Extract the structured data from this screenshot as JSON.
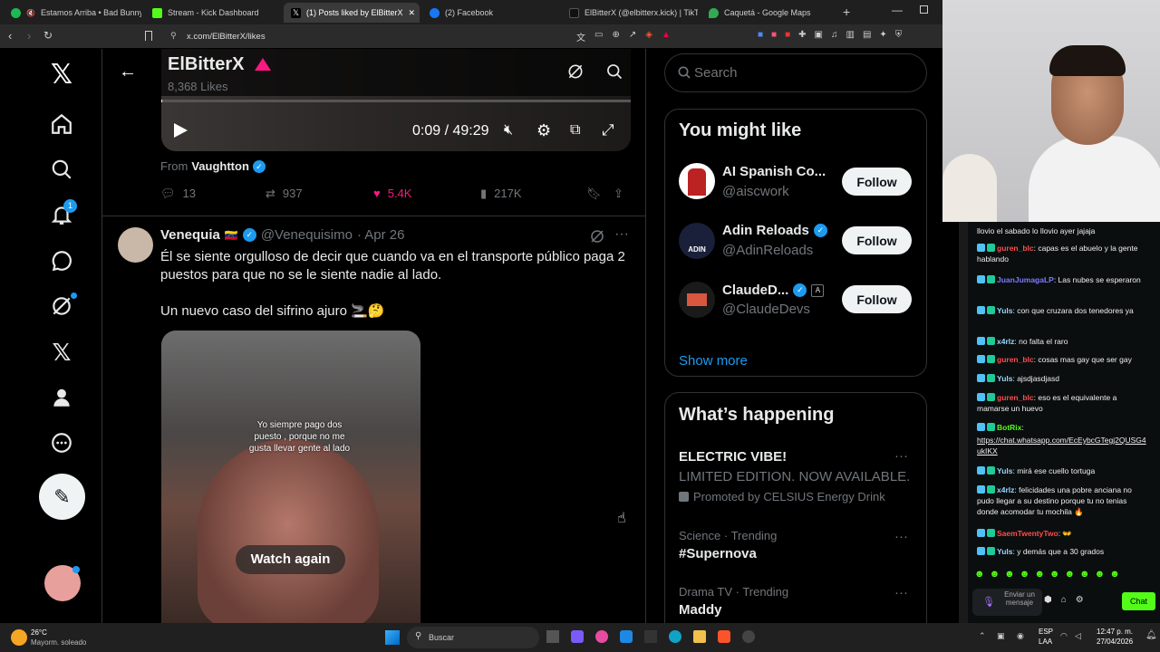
{
  "browser": {
    "tabs": [
      "Estamos Arriba • Bad Bunny, M",
      "Stream - Kick Dashboard",
      "(1) Posts liked by ElBitterX",
      "(2) Facebook",
      "ElBitterX (@elbitterx.kick) | TikTok",
      "Caquetá - Google Maps"
    ],
    "url": "x.com/ElBitterX/likes"
  },
  "profile": {
    "name": "ElBitterX",
    "likes": "8,368 Likes"
  },
  "video": {
    "time": "0:09 / 49:29",
    "from_label": "From",
    "from_name": "Vaughtton"
  },
  "post1_actions": {
    "replies": "13",
    "reposts": "937",
    "likes": "5.4K",
    "views": "217K"
  },
  "post2": {
    "name": "Venequia",
    "handle": "@Venequisimo",
    "date": "· Apr 26",
    "text1": "Él se siente orgulloso de decir que cuando va en el transporte público paga 2 puestos para que no se le siente nadie al lado.",
    "text2": "Un nuevo caso del sifrino ajuro 🚬🤔",
    "video_caption": "Yo siempre pago dos puesto , porque no me gusta llevar gente al lado",
    "watch_again": "Watch again"
  },
  "sidebar": {
    "search_placeholder": "Search",
    "might_like_title": "You might like",
    "suggestions": [
      {
        "name": "AI Spanish Co...",
        "handle": "@aiscwork",
        "follow": "Follow"
      },
      {
        "name": "Adin Reloads",
        "handle": "@AdinReloads",
        "follow": "Follow"
      },
      {
        "name": "ClaudeD...",
        "handle": "@ClaudeDevs",
        "follow": "Follow"
      }
    ],
    "show_more": "Show more",
    "happening_title": "What’s happening",
    "trends": [
      {
        "title": "ELECTRIC VIBE!",
        "sub": "LIMITED EDITION. NOW AVAILABLE.",
        "meta": "Promoted by CELSIUS Energy Drink"
      },
      {
        "meta": "Science · Trending",
        "title": "#Supernova"
      },
      {
        "meta": "Drama TV · Trending",
        "title": "Maddy"
      }
    ]
  },
  "chat": {
    "messages": [
      {
        "user": "",
        "text": "llovio el sabado lo llovio ayer jajaja",
        "color": "#efeff1"
      },
      {
        "user": "guren_blc",
        "text": ": capas es el abuelo y la gente hablando",
        "color": "#ff4d4d"
      },
      {
        "user": "JuanJumagaLP",
        "text": ": Las nubes se esperaron",
        "color": "#7b7bff"
      },
      {
        "user": "Yuls",
        "text": ": con que cruzara dos tenedores ya",
        "color": "#9ad5ff"
      },
      {
        "user": "x4rlz",
        "text": ": no falta el raro",
        "color": "#9ad5ff"
      },
      {
        "user": "guren_blc",
        "text": ": cosas mas gay que ser gay",
        "color": "#ff4d4d"
      },
      {
        "user": "Yuls",
        "text": ": ajsdjasdjasd",
        "color": "#9ad5ff"
      },
      {
        "user": "guren_blc",
        "text": ": eso es el equivalente a mamarse un huevo",
        "color": "#ff4d4d"
      },
      {
        "user": "BotRix",
        "text": ":",
        "color": "#53fc18"
      },
      {
        "user": "",
        "text": "https://chat.whatsapp.com/EcEybcGTegj2QUSG4ukIKX",
        "color": "#efeff1"
      },
      {
        "user": "Yuls",
        "text": ": mirá ese cuello tortuga",
        "color": "#9ad5ff"
      },
      {
        "user": "x4rlz",
        "text": ": felicidades una pobre anciana no pudo llegar a su destino porque tu no tenias donde acomodar tu mochila 🔥",
        "color": "#9ad5ff"
      },
      {
        "user": "SaemTwentyTwo",
        "text": ": 👐",
        "color": "#ff4d4d"
      },
      {
        "user": "Yuls",
        "text": ": y demás que a 30 grados",
        "color": "#9ad5ff"
      }
    ],
    "input_placeholder": "Enviar un mensaje",
    "chat_button": "Chat"
  },
  "taskbar": {
    "weather_temp": "26°C",
    "weather_desc": "Mayorm. soleado",
    "search": "Buscar",
    "lang1": "ESP",
    "lang2": "LAA",
    "time": "12:47 p. m.",
    "date": "27/04/2026"
  }
}
